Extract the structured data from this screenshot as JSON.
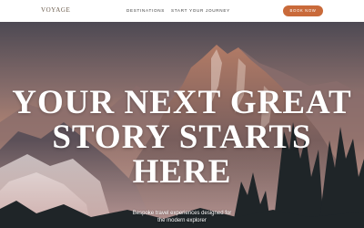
{
  "nav": {
    "logo": "VOYAGE",
    "links": [
      "DESTINATIONS",
      "START YOUR JOURNEY"
    ],
    "cta": "BOOK NOW"
  },
  "hero": {
    "headline_lines": [
      "YOUR NEXT GREAT",
      "STORY STARTS",
      "HERE"
    ],
    "subtitle_lines": [
      "Bespoke travel experiences designed for",
      "the modern explorer"
    ]
  },
  "colors": {
    "accent": "#c96a3a",
    "sky_top": "#4e4b56",
    "sky_glow": "#c98a6e",
    "mountain": "#6e5a5a",
    "forest": "#1c2124"
  }
}
